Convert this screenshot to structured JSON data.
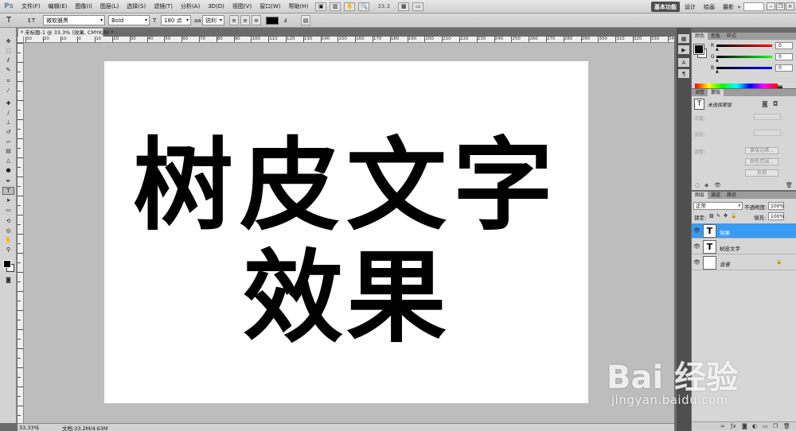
{
  "menubar": {
    "logo": "Ps",
    "items": [
      "文件(F)",
      "编辑(E)",
      "图像(I)",
      "图层(L)",
      "选择(S)",
      "滤镜(T)",
      "分析(A)",
      "3D(D)",
      "视图(V)",
      "窗口(W)",
      "帮助(H)"
    ],
    "zoom": "33.3",
    "workspaces": [
      "基本功能",
      "设计",
      "绘画",
      "摄影"
    ],
    "active_workspace": "基本功能",
    "expand": "»"
  },
  "options": {
    "tool_icon": "T",
    "orient_icon": "↕T",
    "font_family": "微软雅黑",
    "font_style": "Bold",
    "size_icon": "T",
    "font_size": "180 点",
    "aa_icon": "aa",
    "antialias": "锐利",
    "text_color": "#000000"
  },
  "document": {
    "tab_title": "未标题-1 @ 33.3% (效果, CMYK/8) *",
    "close": "×",
    "ruler_labels": [
      "30",
      "20",
      "10",
      "0",
      "10",
      "20",
      "30",
      "40",
      "50",
      "60",
      "70",
      "80",
      "90",
      "100",
      "110",
      "120",
      "130",
      "140",
      "150",
      "160",
      "170",
      "180",
      "190",
      "200",
      "210",
      "220",
      "230",
      "240",
      "250",
      "260",
      "270",
      "280",
      "290",
      "300",
      "310",
      "320",
      "330",
      "340"
    ],
    "canvas_text_line1": "树皮文字",
    "canvas_text_line2": "效果"
  },
  "status": {
    "zoom": "33.33%",
    "doc_info": "文档:33.2M/4.63M"
  },
  "color_panel": {
    "tabs": [
      "颜色",
      "色板",
      "样式"
    ],
    "channels": [
      {
        "label": "R",
        "value": "0",
        "gradient": "#ff0000"
      },
      {
        "label": "G",
        "value": "0",
        "gradient": "#00ff00"
      },
      {
        "label": "B",
        "value": "0",
        "gradient": "#0000ff"
      }
    ]
  },
  "masks_panel": {
    "tabs": [
      "调整",
      "蒙版"
    ],
    "title": "未选择蒙版",
    "row1": "浓度:",
    "row2": "羽化:",
    "row3": "调整:",
    "buttons": [
      "蒙版边缘...",
      "颜色范围...",
      "反相"
    ]
  },
  "layers_panel": {
    "tabs": [
      "图层",
      "通道",
      "路径"
    ],
    "blend_mode": "正常",
    "opacity_label": "不透明度:",
    "opacity": "100%",
    "lock_label": "锁定:",
    "fill_label": "填充:",
    "fill": "100%",
    "layers": [
      {
        "name": "效果",
        "thumb": "T",
        "selected": true
      },
      {
        "name": "树皮文字",
        "thumb": "T",
        "selected": false
      },
      {
        "name": "背景",
        "thumb": "",
        "selected": false
      }
    ]
  },
  "watermark": {
    "logo": "Bai 经验",
    "url": "jingyan.baidu.com"
  }
}
